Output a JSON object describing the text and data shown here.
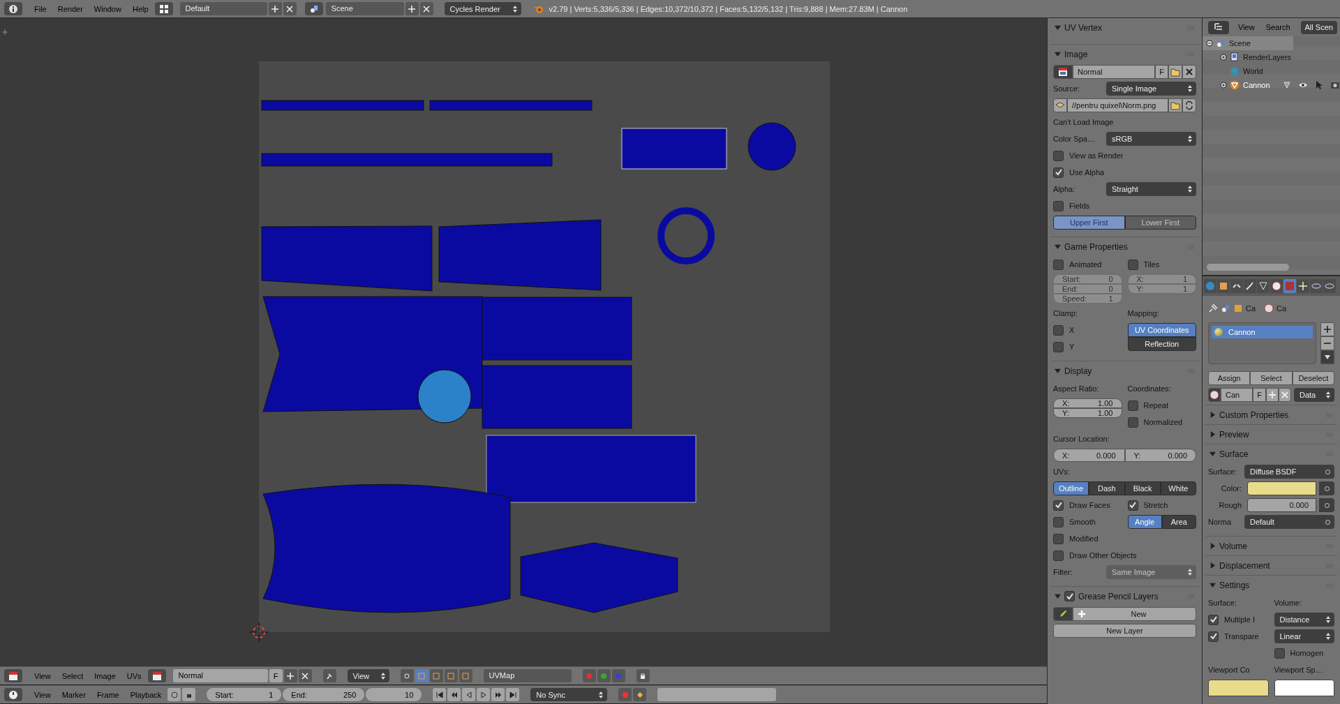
{
  "top_bar": {
    "menus": [
      "File",
      "Render",
      "Window",
      "Help"
    ],
    "layout": "Default",
    "scene": "Scene",
    "engine": "Cycles Render",
    "stats": "v2.79 | Verts:5,336/5,336 | Edges:10,372/10,372 | Faces:5,132/5,132 | Tris:9,888 | Mem:27.83M | Cannon"
  },
  "n_panel": {
    "panels": [
      {
        "title": "UV Vertex",
        "expanded": true
      },
      {
        "title": "Image",
        "expanded": true,
        "rows": [
          {
            "kind": "image_selector",
            "value": "Normal",
            "flag": "F"
          },
          {
            "kind": "dropdown",
            "label": "Source:",
            "value": "Single Image"
          },
          {
            "kind": "file_path",
            "value": "//pentru quixel\\Norm.png"
          },
          {
            "kind": "label",
            "text": "Can't Load Image"
          },
          {
            "kind": "dropdown",
            "label": "Color Spa…",
            "value": "sRGB"
          },
          {
            "kind": "checkbox",
            "label": "View as Render",
            "checked": false
          },
          {
            "kind": "checkbox",
            "label": "Use Alpha",
            "checked": true
          },
          {
            "kind": "dropdown",
            "label": "Alpha:",
            "value": "Straight"
          },
          {
            "kind": "checkbox",
            "label": "Fields",
            "checked": false
          },
          {
            "kind": "toggle_group",
            "disabled": true,
            "options": [
              {
                "label": "Upper First",
                "selected": true
              },
              {
                "label": "Lower First",
                "selected": false
              }
            ]
          }
        ]
      },
      {
        "title": "Game Properties",
        "expanded": true,
        "rows": [
          {
            "kind": "columns",
            "columns": [
              {
                "rows": [
                  {
                    "kind": "checkbox",
                    "label": "Animated",
                    "checked": false
                  },
                  {
                    "kind": "number_group",
                    "fields": [
                      {
                        "label": "Start:",
                        "value": "0",
                        "disabled": true
                      },
                      {
                        "label": "End:",
                        "value": "0",
                        "disabled": true
                      },
                      {
                        "label": "Speed:",
                        "value": "1",
                        "disabled": true
                      }
                    ]
                  }
                ]
              },
              {
                "rows": [
                  {
                    "kind": "checkbox",
                    "label": "Tiles",
                    "checked": false
                  },
                  {
                    "kind": "number_group",
                    "fields": [
                      {
                        "label": "X:",
                        "value": "1",
                        "disabled": true
                      },
                      {
                        "label": "Y:",
                        "value": "1",
                        "disabled": true
                      }
                    ]
                  }
                ]
              }
            ]
          },
          {
            "kind": "columns",
            "columns": [
              {
                "rows": [
                  {
                    "kind": "label",
                    "text": "Clamp:"
                  },
                  {
                    "kind": "checkbox",
                    "label": "X",
                    "checked": false
                  },
                  {
                    "kind": "checkbox",
                    "label": "Y",
                    "checked": false
                  }
                ]
              },
              {
                "rows": [
                  {
                    "kind": "label",
                    "text": "Mapping:"
                  },
                  {
                    "kind": "toggle_column",
                    "options": [
                      {
                        "label": "UV Coordinates",
                        "selected": true
                      },
                      {
                        "label": "Reflection",
                        "selected": false
                      }
                    ]
                  }
                ]
              }
            ]
          }
        ]
      },
      {
        "title": "Display",
        "expanded": true,
        "rows": [
          {
            "kind": "columns",
            "columns": [
              {
                "rows": [
                  {
                    "kind": "label",
                    "text": "Aspect Ratio:"
                  },
                  {
                    "kind": "number_group",
                    "fields": [
                      {
                        "label": "X:",
                        "value": "1.00",
                        "disabled": false
                      },
                      {
                        "label": "Y:",
                        "value": "1.00",
                        "disabled": false
                      }
                    ]
                  }
                ]
              },
              {
                "rows": [
                  {
                    "kind": "label",
                    "text": "Coordinates:"
                  },
                  {
                    "kind": "checkbox",
                    "label": "Repeat",
                    "checked": false
                  },
                  {
                    "kind": "checkbox",
                    "label": "Normalized",
                    "checked": false
                  }
                ]
              }
            ]
          },
          {
            "kind": "label",
            "text": "Cursor Location:"
          },
          {
            "kind": "number_row",
            "fields": [
              {
                "label": "X:",
                "value": "0.000",
                "disabled": false
              },
              {
                "label": "Y:",
                "value": "0.000",
                "disabled": false
              }
            ]
          },
          {
            "kind": "label",
            "text": "UVs:"
          },
          {
            "kind": "toggle_group",
            "disabled": false,
            "options": [
              {
                "label": "Outline",
                "selected": true
              },
              {
                "label": "Dash",
                "selected": false
              },
              {
                "label": "Black",
                "selected": false
              },
              {
                "label": "White",
                "selected": false
              }
            ]
          },
          {
            "kind": "columns",
            "columns": [
              {
                "rows": [
                  {
                    "kind": "checkbox",
                    "label": "Draw Faces",
                    "checked": true
                  },
                  {
                    "kind": "checkbox",
                    "label": "Smooth",
                    "checked": false
                  },
                  {
                    "kind": "checkbox",
                    "label": "Modified",
                    "checked": false
                  }
                ]
              },
              {
                "rows": [
                  {
                    "kind": "checkbox",
                    "label": "Stretch",
                    "checked": true
                  },
                  {
                    "kind": "toggle_group",
                    "disabled": false,
                    "options": [
                      {
                        "label": "Angle",
                        "selected": true
                      },
                      {
                        "label": "Area",
                        "selected": false
                      }
                    ]
                  }
                ]
              }
            ]
          },
          {
            "kind": "checkbox",
            "label": "Draw Other Objects",
            "checked": false
          },
          {
            "kind": "dropdown",
            "label": "Filter:",
            "value": "Same Image",
            "disabled": true
          }
        ]
      },
      {
        "title": "Grease Pencil Layers",
        "expanded": true,
        "checked": true,
        "rows": [
          {
            "kind": "new_row",
            "label": "New"
          },
          {
            "kind": "button",
            "label": "New Layer"
          }
        ]
      }
    ]
  },
  "outliner": {
    "menus": [
      "View",
      "Search"
    ],
    "scope": "All Scen",
    "tree": [
      {
        "label": "Scene",
        "kind": "scene",
        "expanded": true,
        "selected": true,
        "children": [
          {
            "label": "RenderLayers",
            "kind": "render_layers",
            "expanded": false,
            "selected": false
          },
          {
            "label": "World",
            "kind": "world",
            "selected": false
          },
          {
            "label": "Cannon",
            "kind": "object",
            "expanded": false,
            "selected": false
          }
        ]
      }
    ]
  },
  "properties": {
    "tabs": [
      {
        "selected": false
      },
      {
        "selected": false
      },
      {
        "selected": false
      },
      {
        "selected": false
      },
      {
        "selected": false
      },
      {
        "selected": false
      },
      {
        "selected": true
      },
      {
        "selected": false
      },
      {
        "selected": false
      },
      {
        "selected": false
      }
    ],
    "breadcrumb": [
      "Ca",
      "Ca"
    ],
    "slots": [
      {
        "label": "Cannon",
        "selected": true
      }
    ],
    "slot_buttons": [
      "Assign",
      "Select",
      "Deselect"
    ],
    "material": {
      "name": "Can",
      "flag": "F",
      "link": "Data"
    },
    "panels": [
      {
        "title": "Custom Properties",
        "expanded": false
      },
      {
        "title": "Preview",
        "expanded": false
      },
      {
        "title": "Surface",
        "expanded": true,
        "rows": [
          {
            "kind": "dropdown",
            "label": "Surface:",
            "value": "Diffuse BSDF",
            "socket": true
          },
          {
            "kind": "color_field",
            "label": "Color:",
            "color": "#e8dc8a"
          },
          {
            "kind": "number_field",
            "label": "Rough",
            "value": "0.000"
          },
          {
            "kind": "dropdown",
            "label": "Norma",
            "value": "Default",
            "socket": true
          }
        ]
      },
      {
        "title": "Volume",
        "expanded": false
      },
      {
        "title": "Displacement",
        "expanded": false
      },
      {
        "title": "Settings",
        "expanded": true,
        "rows": [
          {
            "kind": "columns",
            "columns": [
              {
                "rows": [
                  {
                    "kind": "label",
                    "text": "Surface:"
                  },
                  {
                    "kind": "checkbox",
                    "label": "Multiple I",
                    "checked": true
                  },
                  {
                    "kind": "checkbox",
                    "label": "Transpare",
                    "checked": true
                  }
                ]
              },
              {
                "rows": [
                  {
                    "kind": "label",
                    "text": "Volume:"
                  },
                  {
                    "kind": "dropdown",
                    "value": "Distance"
                  },
                  {
                    "kind": "dropdown",
                    "value": "Linear"
                  },
                  {
                    "kind": "checkbox",
                    "label": "Homogen",
                    "checked": false
                  }
                ]
              }
            ]
          },
          {
            "kind": "columns",
            "columns": [
              {
                "rows": [
                  {
                    "kind": "label",
                    "text": "Viewport Co"
                  },
                  {
                    "kind": "swatch",
                    "color": "#e8dc8a"
                  }
                ]
              },
              {
                "rows": [
                  {
                    "kind": "label",
                    "text": "Viewport Sp…"
                  },
                  {
                    "kind": "swatch",
                    "color": "#ffffff"
                  }
                ]
              }
            ]
          }
        ]
      }
    ]
  },
  "uv_header": {
    "menus": [
      "View",
      "Select",
      "Image",
      "UVs"
    ],
    "image": "Normal",
    "image_flag": "F",
    "view_mode": "View",
    "uv_map": "UVMap",
    "select_modes": [
      {
        "selected": true
      },
      {
        "selected": false
      },
      {
        "selected": false
      },
      {
        "selected": false
      }
    ]
  },
  "timeline": {
    "menus": [
      "View",
      "Marker",
      "Frame",
      "Playback"
    ],
    "start": {
      "label": "Start:",
      "value": "1"
    },
    "end": {
      "label": "End:",
      "value": "250"
    },
    "current": "10",
    "sync": "No Sync"
  }
}
